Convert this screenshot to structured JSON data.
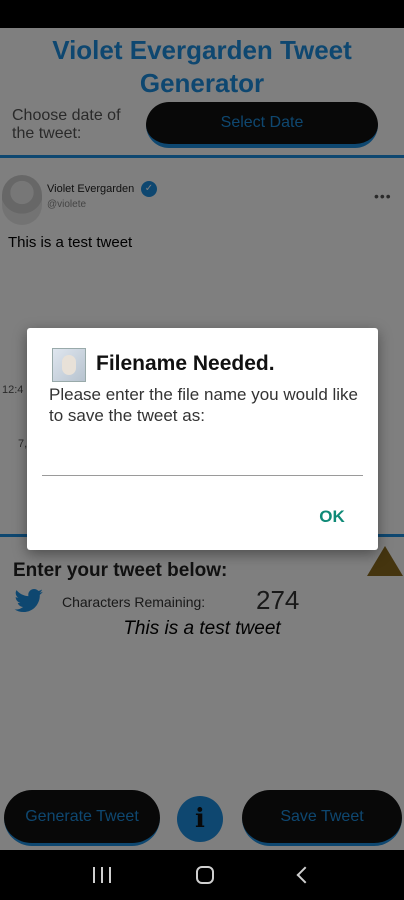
{
  "app": {
    "title": "Violet Evergarden Tweet Generator",
    "date_label": "Choose date of the tweet:",
    "select_date_label": "Select Date"
  },
  "tweet_preview": {
    "user_name": "Violet Evergarden",
    "handle": "@violete",
    "text": "This is a test tweet",
    "time_partial": "12:4",
    "meta_partial": "7,"
  },
  "composer": {
    "heading": "Enter your tweet below:",
    "chars_label": "Characters Remaining:",
    "chars_count": "274",
    "preview_text": "This is a test tweet"
  },
  "buttons": {
    "generate": "Generate Tweet",
    "info": "i",
    "save": "Save Tweet"
  },
  "dialog": {
    "title": "Filename Needed.",
    "message": "Please enter the file name you would like to save the tweet as:",
    "input_value": "",
    "ok_label": "OK"
  },
  "icons": {
    "verified": "verified-badge-icon",
    "more": "more-options-icon",
    "twitter": "twitter-bird-icon",
    "triangle": "triangle-icon",
    "info": "info-icon",
    "dialog": "app-icon"
  },
  "colors": {
    "accent": "#1d8fe1",
    "button_bg": "#111111",
    "ok": "#0f8a77"
  }
}
